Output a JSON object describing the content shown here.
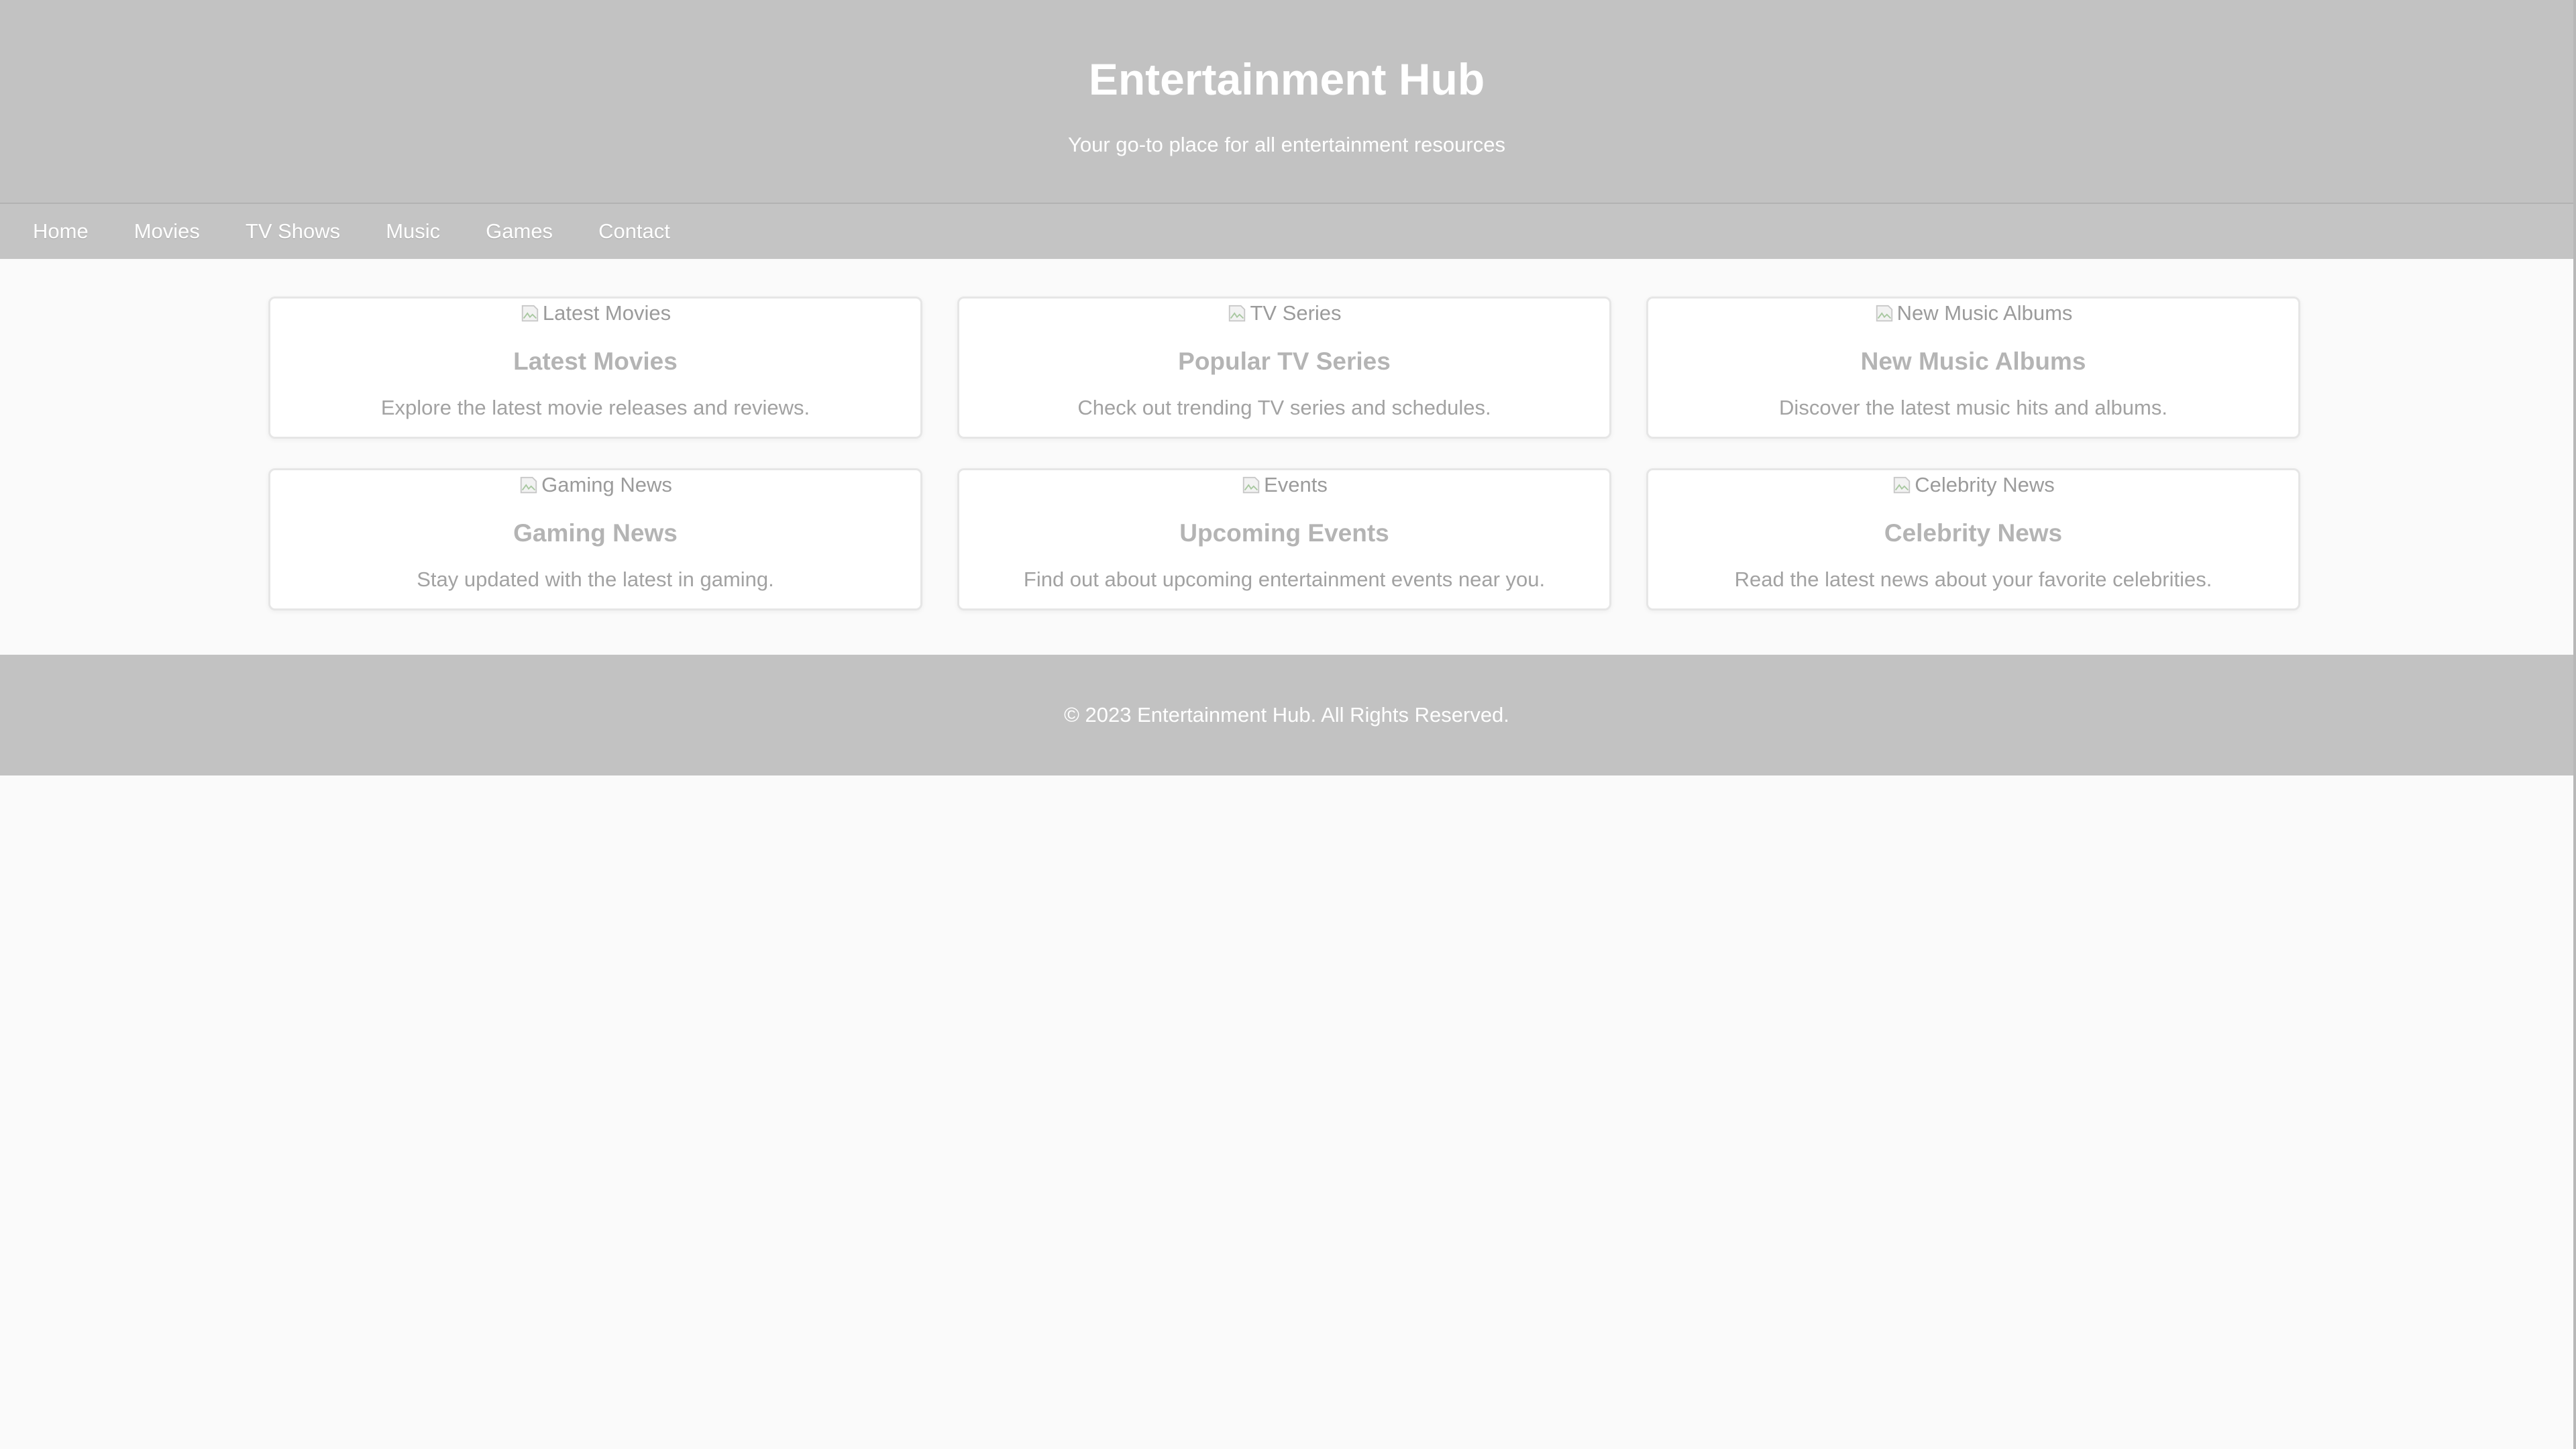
{
  "header": {
    "title": "Entertainment Hub",
    "tagline": "Your go-to place for all entertainment resources"
  },
  "nav": {
    "items": [
      {
        "label": "Home"
      },
      {
        "label": "Movies"
      },
      {
        "label": "TV Shows"
      },
      {
        "label": "Music"
      },
      {
        "label": "Games"
      },
      {
        "label": "Contact"
      }
    ]
  },
  "cards": [
    {
      "img_alt": "Latest Movies",
      "title": "Latest Movies",
      "desc": "Explore the latest movie releases and reviews."
    },
    {
      "img_alt": "TV Series",
      "title": "Popular TV Series",
      "desc": "Check out trending TV series and schedules."
    },
    {
      "img_alt": "New Music Albums",
      "title": "New Music Albums",
      "desc": "Discover the latest music hits and albums."
    },
    {
      "img_alt": "Gaming News",
      "title": "Gaming News",
      "desc": "Stay updated with the latest in gaming."
    },
    {
      "img_alt": "Events",
      "title": "Upcoming Events",
      "desc": "Find out about upcoming entertainment events near you."
    },
    {
      "img_alt": "Celebrity News",
      "title": "Celebrity News",
      "desc": "Read the latest news about your favorite celebrities."
    }
  ],
  "footer": {
    "text": "© 2023 Entertainment Hub. All Rights Reserved."
  },
  "colors": {
    "header_bg": "#c2c2c2",
    "page_bg": "#fafafa",
    "card_bg": "#ffffff",
    "text_light": "#ffffff"
  },
  "icons": {
    "card_image": "broken-image-icon"
  }
}
